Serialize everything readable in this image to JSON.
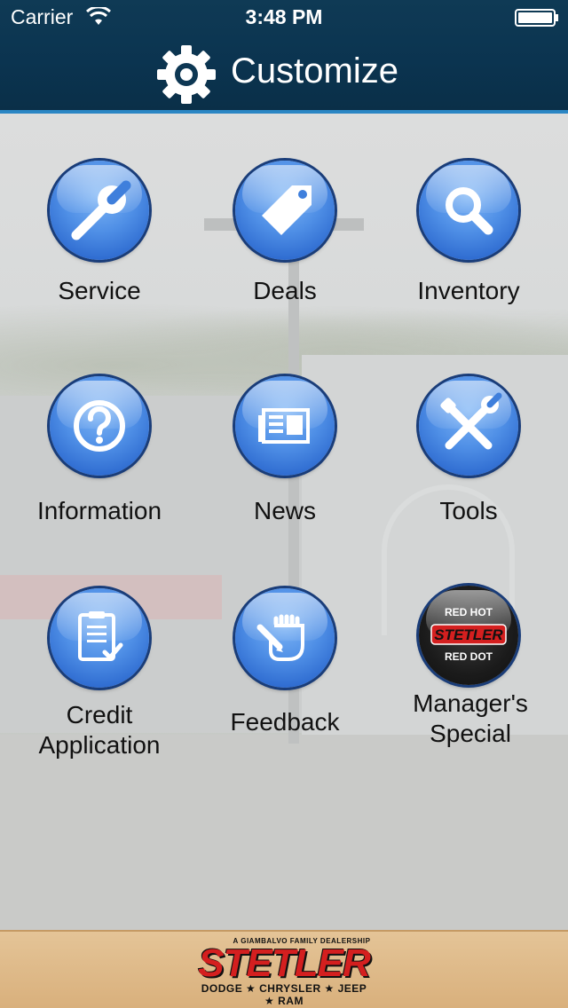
{
  "status_bar": {
    "carrier": "Carrier",
    "time": "3:48 PM"
  },
  "header": {
    "title": "Customize",
    "icon": "gear-icon"
  },
  "colors": {
    "header_bg": "#0b3450",
    "header_accent": "#2a86c4",
    "button_blue": "#4f8fe6",
    "footer_bg": "#d9b07c",
    "logo_red": "#d41f1f"
  },
  "menu": [
    {
      "label": "Service",
      "icon": "wrench-icon"
    },
    {
      "label": "Deals",
      "icon": "price-tag-icon"
    },
    {
      "label": "Inventory",
      "icon": "magnifier-icon"
    },
    {
      "label": "Information",
      "icon": "question-mark-icon"
    },
    {
      "label": "News",
      "icon": "newspaper-icon"
    },
    {
      "label": "Tools",
      "icon": "tools-icon"
    },
    {
      "label": "Credit Application",
      "icon": "clipboard-check-icon"
    },
    {
      "label": "Feedback",
      "icon": "hand-writing-icon"
    },
    {
      "label": "Manager's Special",
      "icon": "stetler-red-hot-red-dot-logo",
      "badge_top": "RED HOT",
      "badge_brand": "STETLER",
      "badge_bottom": "RED DOT"
    }
  ],
  "footer": {
    "tagline": "A GIAMBALVO FAMILY DEALERSHIP",
    "brand": "STETLER",
    "makes": "DODGE ★ CHRYSLER ★ JEEP ★ RAM"
  }
}
